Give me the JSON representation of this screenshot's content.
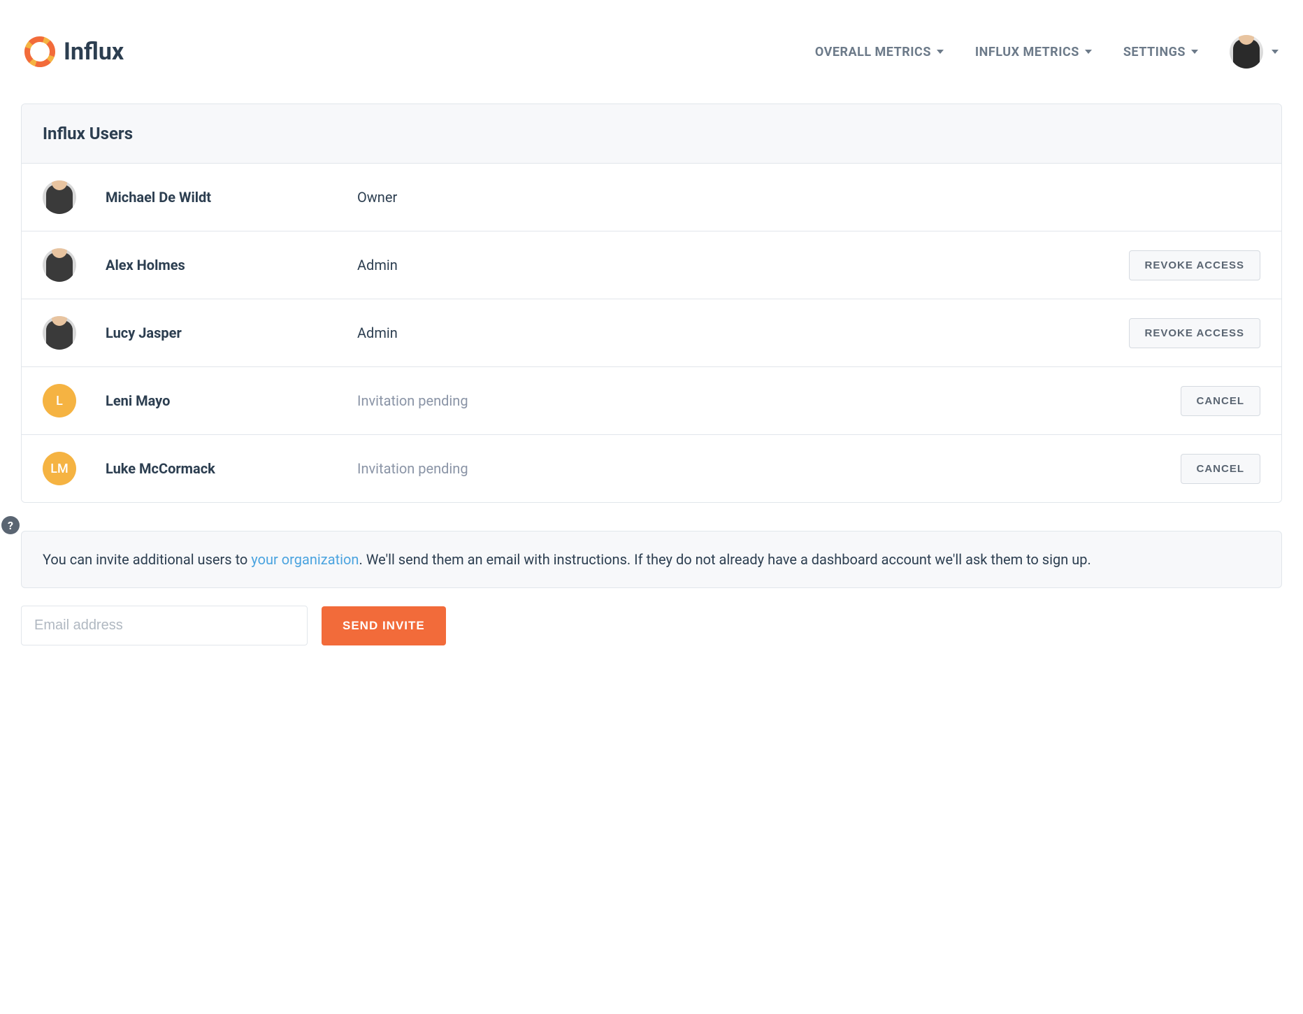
{
  "brand": {
    "name": "Influx"
  },
  "nav": {
    "items": [
      {
        "label": "OVERALL METRICS"
      },
      {
        "label": "INFLUX METRICS"
      },
      {
        "label": "SETTINGS"
      }
    ]
  },
  "panel": {
    "title": "Influx Users"
  },
  "users": [
    {
      "name": "Michael De Wildt",
      "role": "Owner",
      "pending": false,
      "avatar_type": "photo",
      "initials": "",
      "action": ""
    },
    {
      "name": "Alex Holmes",
      "role": "Admin",
      "pending": false,
      "avatar_type": "photo",
      "initials": "",
      "action": "REVOKE ACCESS"
    },
    {
      "name": "Lucy Jasper",
      "role": "Admin",
      "pending": false,
      "avatar_type": "photo",
      "initials": "",
      "action": "REVOKE ACCESS"
    },
    {
      "name": "Leni Mayo",
      "role": "Invitation pending",
      "pending": true,
      "avatar_type": "initials",
      "initials": "L",
      "action": "CANCEL"
    },
    {
      "name": "Luke McCormack",
      "role": "Invitation pending",
      "pending": true,
      "avatar_type": "initials",
      "initials": "LM",
      "action": "CANCEL"
    }
  ],
  "info": {
    "text_before": "You can invite additional users to ",
    "link_text": "your organization",
    "text_after": ". We'll send them an email with instructions. If they do not already have a dashboard account we'll ask them to sign up."
  },
  "invite": {
    "placeholder": "Email address",
    "button": "SEND INVITE"
  },
  "help": {
    "label": "?"
  }
}
